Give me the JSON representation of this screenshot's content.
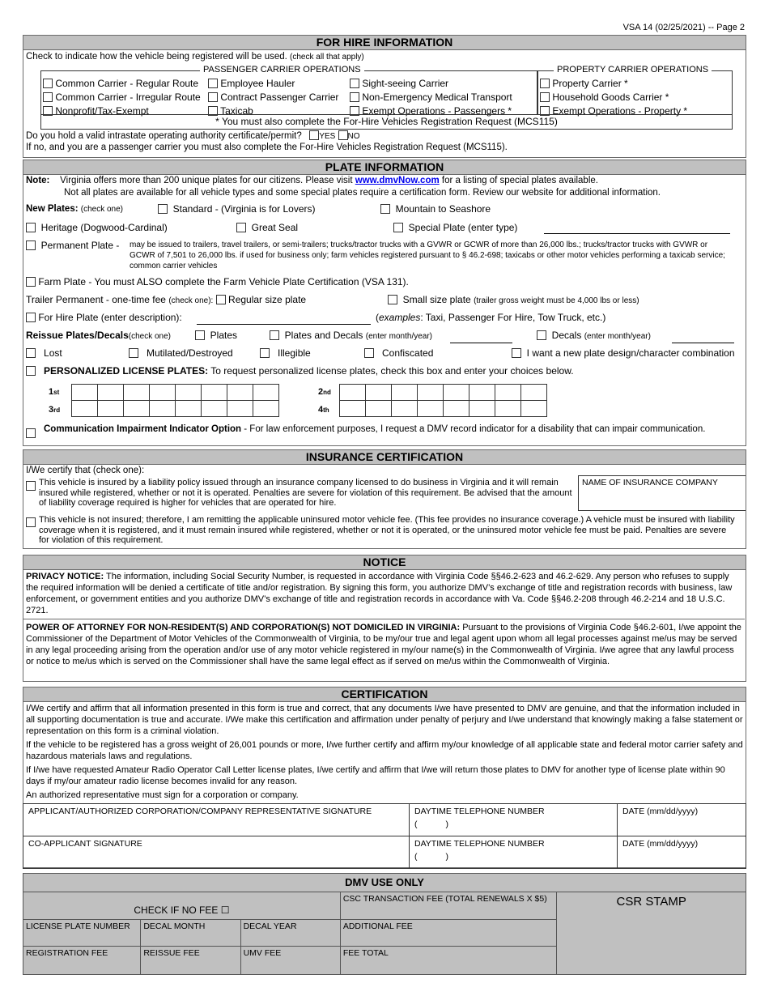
{
  "form_number": "VSA 14 (02/25/2021)  --  Page 2",
  "for_hire": {
    "title": "FOR HIRE INFORMATION",
    "instruction": "Check to indicate how the vehicle being registered will be used.",
    "instruction_note": "(check all that apply)",
    "passenger_legend": "PASSENGER CARRIER OPERATIONS",
    "passenger_items": [
      "Common Carrier - Regular Route",
      "Employee Hauler",
      "Sight-seeing Carrier",
      "Common Carrier - Irregular Route",
      "Contract Passenger Carrier",
      "Non-Emergency Medical Transport",
      "Nonprofit/Tax-Exempt",
      "Taxicab",
      "Exempt Operations - Passengers *"
    ],
    "property_legend": "PROPERTY CARRIER OPERATIONS",
    "property_items": [
      "Property Carrier *",
      "Household Goods Carrier *",
      "Exempt Operations - Property *"
    ],
    "footnote": "*  You must also complete the For-Hire Vehicles Registration Request (MCS115)",
    "question": "Do you hold a valid intrastate operating authority certificate/permit?",
    "yes": "YES",
    "no": "NO",
    "if_no": "If no, and you are a passenger carrier you must also complete the For-Hire Vehicles Registration Request (MCS115)."
  },
  "plate": {
    "title": "PLATE INFORMATION",
    "note_label": "Note:",
    "note_line1_a": "Virginia offers more than 200 unique plates for our citizens. Please visit",
    "note_link": "www.dmvNow.com",
    "note_line1_b": "for a listing of special plates available.",
    "note_line2": "Not all plates are available for all vehicle types and some special plates require a certification form.  Review our website for additional information.",
    "new_plates_label": "New Plates:",
    "new_plates_note": "(check one)",
    "standard": "Standard - (Virginia is for Lovers)",
    "mountain": "Mountain to Seashore",
    "heritage": "Heritage (Dogwood-Cardinal)",
    "great_seal": "Great Seal",
    "special": "Special Plate (enter type)",
    "permanent_label": "Permanent Plate -",
    "permanent_text": "may be issued to trailers, travel trailers, or semi-trailers; trucks/tractor trucks with a GVWR or GCWR of more than 26,000 lbs.; trucks/tractor trucks with GVWR or GCWR of 7,501 to 26,000 lbs. if used for business only; farm vehicles registered pursuant to § 46.2-698; taxicabs or other motor vehicles performing a taxicab service; common carrier vehicles",
    "farm": "Farm Plate - You must ALSO complete the Farm Vehicle Plate Certification (VSA 131).",
    "trailer_label": "Trailer Permanent - one-time fee",
    "trailer_note": "(check one):",
    "regular_size": "Regular size plate",
    "small_size": "Small size plate",
    "small_size_note": "(trailer gross weight must be 4,000 lbs or less)",
    "for_hire_plate": "For Hire Plate (enter description):",
    "examples_label": "examples",
    "examples_text": ": Taxi, Passenger For Hire, Tow Truck, etc.)",
    "reissue_label": "Reissue Plates/Decals",
    "reissue_note": "(check one)",
    "plates": "Plates",
    "plates_decals": "Plates and Decals",
    "enter_month_year": "(enter month/year)",
    "decals": "Decals",
    "lost": "Lost",
    "mutilated": "Mutilated/Destroyed",
    "illegible": "Illegible",
    "confiscated": "Confiscated",
    "new_design": "I want a new plate design/character combination",
    "personalized_label": "PERSONALIZED LICENSE PLATES:",
    "personalized_text": "To request personalized license plates, check this box and enter your choices below.",
    "choices": [
      {
        "num": "1",
        "suffix": "st"
      },
      {
        "num": "2",
        "suffix": "nd"
      },
      {
        "num": "3",
        "suffix": "rd"
      },
      {
        "num": "4",
        "suffix": "th"
      }
    ],
    "comm_label": "Communication Impairment Indicator Option",
    "comm_text": " - For law enforcement purposes, I request a DMV record indicator for a disability that can impair communication."
  },
  "insurance": {
    "title": "INSURANCE CERTIFICATION",
    "intro": "I/We certify that (check one):",
    "option1": "This vehicle is insured by a liability policy issued through an insurance company licensed to do business in Virginia and it will remain insured while registered, whether or not it is operated.  Penalties are severe for violation of this requirement. Be advised that the amount of liability coverage required is higher for vehicles that are operated for hire.",
    "company_label": "NAME OF INSURANCE COMPANY",
    "option2": "This vehicle is not insured; therefore, I am remitting the applicable uninsured motor vehicle fee. (This fee provides no insurance coverage.)  A vehicle must be insured with liability coverage when it is registered, and it must remain insured while registered, whether or not it is operated, or the uninsured motor vehicle fee must be paid. Penalties are severe for violation of this requirement."
  },
  "notice": {
    "title": "NOTICE",
    "privacy_label": "PRIVACY NOTICE:",
    "privacy_text": "  The information, including Social Security Number, is requested in accordance with Virginia Code §§46.2-623 and 46.2-629. Any person who refuses to supply the required information will be denied a certificate of title and/or registration. By signing this form, you authorize DMV’s exchange of title and registration records with business, law enforcement, or government entities and you authorize DMV’s exchange of title and registration records in accordance with Va. Code §§46.2-208 through 46.2-214 and 18 U.S.C. 2721.",
    "poa_label": "POWER OF ATTORNEY FOR NON-RESIDENT(S) AND CORPORATION(S) NOT DOMICILED IN VIRGINIA:",
    "poa_text": " Pursuant to the provisions of Virginia Code §46.2-601, I/we appoint the Commissioner of the Department of Motor Vehicles of the Commonwealth of Virginia, to be my/our true and legal agent upon whom all legal processes against me/us may be served in any legal proceeding arising from the operation and/or use of any motor vehicle registered in my/our name(s) in the Commonwealth of Virginia. I/we agree that any lawful process or notice to me/us which is served on the Commissioner shall have the same legal effect as if served on me/us within the Commonwealth of Virginia."
  },
  "certification": {
    "title": "CERTIFICATION",
    "paragraphs": [
      "I/We certify and affirm that all information presented in this form is true and correct, that any documents I/we have presented to DMV are genuine, and that the information included in all supporting documentation is true and accurate.  I/We make this certification and affirmation under penalty of perjury and I/we understand that knowingly making a false statement or representation on this form is a criminal violation.",
      "If the vehicle to be registered has a gross weight of 26,001 pounds or more, I/we further certify and affirm my/our knowledge of all applicable state and federal motor carrier safety and hazardous materials laws and regulations.",
      "If I/we have requested Amateur Radio Operator Call Letter license plates, I/we certify and affirm that I/we will return those plates to DMV for another type of license plate within 90 days if my/our amateur radio license becomes invalid for any reason.",
      "An authorized representative must sign for a corporation or company."
    ],
    "applicant_sig": "APPLICANT/AUTHORIZED CORPORATION/COMPANY REPRESENTATIVE SIGNATURE",
    "co_applicant_sig": "CO-APPLICANT SIGNATURE",
    "phone_label": "DAYTIME TELEPHONE NUMBER",
    "phone_paren": "(            )",
    "date_label": "DATE (mm/dd/yyyy)"
  },
  "dmv": {
    "title": "DMV USE ONLY",
    "no_fee": "CHECK IF NO FEE  ☐",
    "csc_fee": "CSC TRANSACTION FEE (TOTAL RENEWALS X $5)",
    "csr_stamp": "CSR STAMP",
    "license_plate": "LICENSE PLATE NUMBER",
    "decal_month": "DECAL MONTH",
    "decal_year": "DECAL YEAR",
    "additional_fee": "ADDITIONAL FEE",
    "registration_fee": "REGISTRATION FEE",
    "reissue_fee": "REISSUE FEE",
    "umv_fee": "UMV FEE",
    "fee_total": "FEE TOTAL"
  }
}
